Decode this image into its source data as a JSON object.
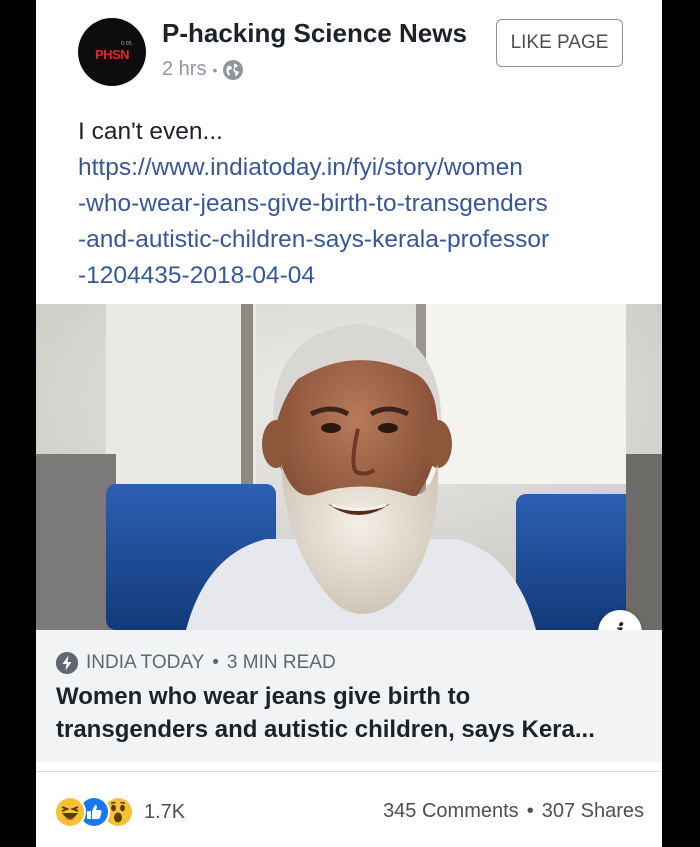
{
  "post": {
    "page_name": "P-hacking Science News",
    "avatar_text": "PHSN",
    "avatar_sup": "0.05",
    "time": "2 hrs",
    "audience_icon": "globe-icon",
    "like_button": "LIKE PAGE",
    "text": "I can't even...",
    "link_lines": [
      "https://www.indiatoday.in/fyi/story/women",
      "-who-wear-jeans-give-birth-to-transgenders",
      "-and-autistic-children-says-kerala-professor",
      "-1204435-2018-04-04"
    ]
  },
  "preview": {
    "info_label": "i",
    "source": "INDIA TODAY",
    "read_time": "3 MIN READ",
    "headline_lines": [
      "Women who wear jeans give birth to",
      "transgenders and autistic children, says Kera..."
    ]
  },
  "footer": {
    "reaction_icons": [
      "haha-icon",
      "like-icon",
      "wow-icon"
    ],
    "reaction_count": "1.7K",
    "comments": "345 Comments",
    "shares": "307 Shares"
  },
  "colors": {
    "link": "#365899",
    "text": "#1d2129",
    "meta": "#90949c",
    "preview_bg": "#f2f3f5",
    "like_blue": "#1877f2",
    "emoji_yellow": "#f7c035"
  }
}
